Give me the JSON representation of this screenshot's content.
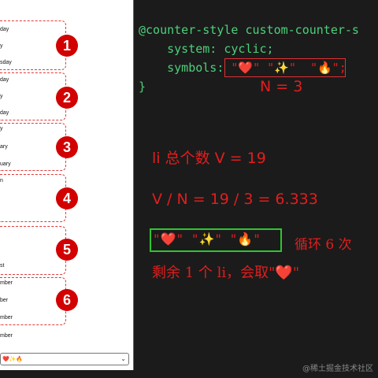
{
  "preview": {
    "items": [
      "day",
      "y",
      "sday",
      "day",
      "y",
      "day",
      "y",
      "ary",
      "uary",
      "n",
      "",
      "",
      "",
      "",
      "st",
      "mber",
      "ber",
      "mber",
      "mber"
    ],
    "badges": [
      "1",
      "2",
      "3",
      "4",
      "5",
      "6"
    ],
    "select_value": "❤️✨🔥",
    "select_chevron": "⌄"
  },
  "code": {
    "line1": "@counter-style custom-counter-s",
    "line2": "    system: cyclic;",
    "line3_prefix": "    symbols:",
    "line3_symbols": "\"❤️\" \"✨\"  \"🔥\";",
    "line4": "}"
  },
  "annotations": {
    "n_eq": "N = 3",
    "total": "li 总个数 V = 19",
    "division": "V / N = 19 / 3 = 6.333",
    "symbols_again": "\"❤️\" \"✨\" \"🔥\"",
    "cycle_text": "循环 6 次",
    "remainder": "剩余 1 个 li，会取\"❤️\""
  },
  "watermark": "@稀土掘金技术社区"
}
